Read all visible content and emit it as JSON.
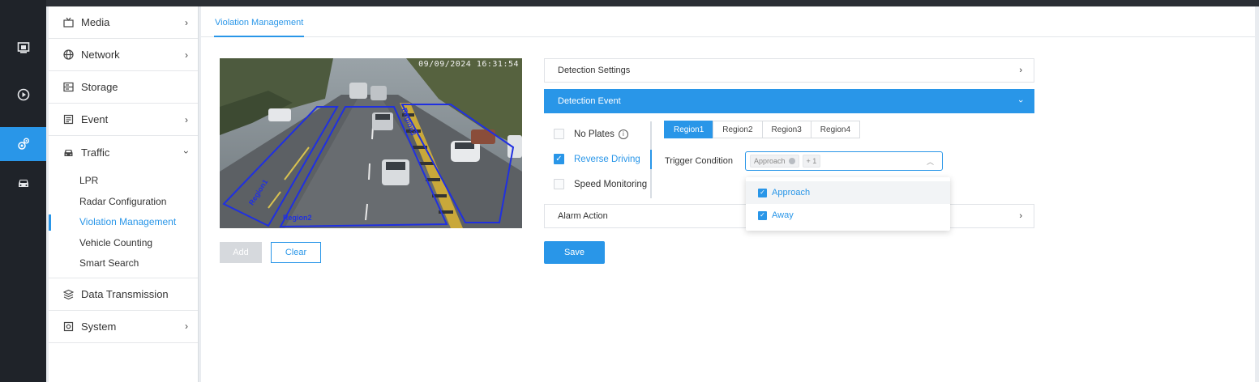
{
  "rail": {
    "icons": [
      "monitor-icon",
      "play-icon",
      "settings-icon",
      "car-icon"
    ]
  },
  "menu": {
    "items": [
      {
        "label": "Media",
        "icon": "media-icon",
        "has_chevron": true
      },
      {
        "label": "Network",
        "icon": "globe-icon",
        "has_chevron": true
      },
      {
        "label": "Storage",
        "icon": "storage-icon",
        "has_chevron": false
      },
      {
        "label": "Event",
        "icon": "event-icon",
        "has_chevron": true
      },
      {
        "label": "Traffic",
        "icon": "car-icon",
        "expanded": true
      },
      {
        "label": "Data Transmission",
        "icon": "layers-icon",
        "has_chevron": false
      },
      {
        "label": "System",
        "icon": "system-icon",
        "has_chevron": true
      }
    ],
    "traffic_sub": [
      "LPR",
      "Radar Configuration",
      "Violation Management",
      "Vehicle Counting",
      "Smart Search"
    ],
    "active_sub": "Violation Management"
  },
  "tab": {
    "label": "Violation Management"
  },
  "preview": {
    "timestamp": "09/09/2024 16:31:54",
    "region_labels": [
      "Region1",
      "Region2",
      "Region3"
    ]
  },
  "buttons": {
    "add": "Add",
    "clear": "Clear",
    "save": "Save"
  },
  "panels": {
    "detection_settings": "Detection Settings",
    "detection_event": "Detection Event",
    "alarm_action": "Alarm Action"
  },
  "events": {
    "no_plates": "No Plates",
    "reverse_driving": "Reverse Driving",
    "speed_monitoring": "Speed Monitoring"
  },
  "regions": [
    "Region1",
    "Region2",
    "Region3",
    "Region4"
  ],
  "trigger": {
    "label": "Trigger Condition",
    "tag": "Approach",
    "more": "+ 1",
    "options": [
      "Approach",
      "Away"
    ]
  },
  "colors": {
    "accent": "#2996e8",
    "rail": "#1f2329"
  }
}
